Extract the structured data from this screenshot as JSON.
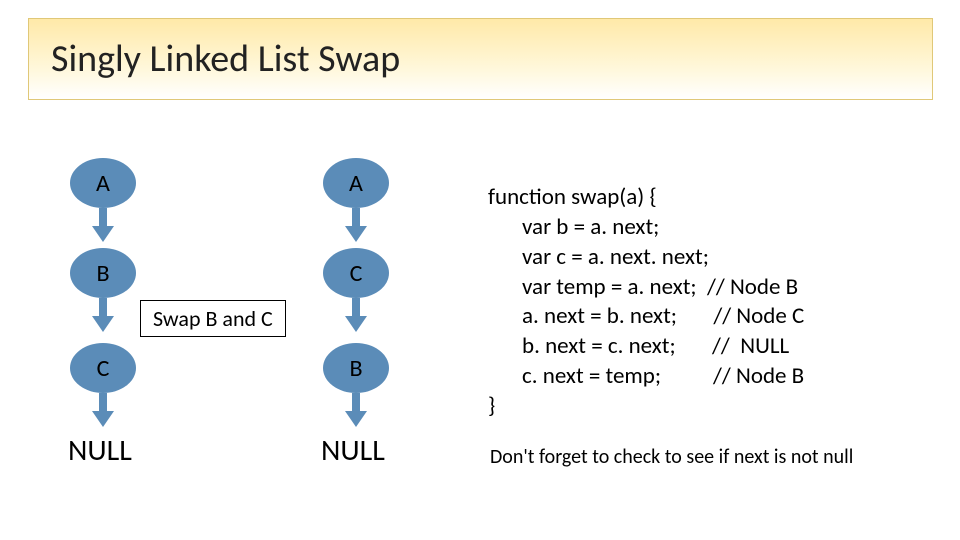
{
  "title": "Singly Linked List Swap",
  "left_chain": {
    "nodes": [
      "A",
      "B",
      "C"
    ],
    "terminal": "NULL"
  },
  "right_chain": {
    "nodes": [
      "A",
      "C",
      "B"
    ],
    "terminal": "NULL"
  },
  "swap_label": "Swap B and C",
  "code": {
    "line1": "function swap(a) {",
    "line2": "var b = a. next;",
    "line3": "var c = a. next. next;",
    "line4": "var temp = a. next;  // Node B",
    "line5": "a. next = b. next;       // Node C",
    "line6": "b. next = c. next;       //  NULL",
    "line7": "c. next = temp;          // Node B",
    "line8": "}"
  },
  "footnote": "Don't forget to check to see if next is not null"
}
